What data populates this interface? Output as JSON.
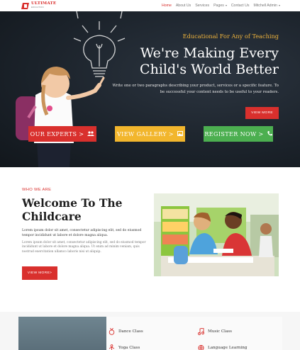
{
  "header": {
    "logo_title": "ULTIMATE",
    "logo_sub": "EDUCATION",
    "nav": [
      {
        "label": "Home",
        "active": true,
        "dropdown": false
      },
      {
        "label": "About Us",
        "active": false,
        "dropdown": false
      },
      {
        "label": "Services",
        "active": false,
        "dropdown": false
      },
      {
        "label": "Pages",
        "active": false,
        "dropdown": true
      },
      {
        "label": "Contact Us",
        "active": false,
        "dropdown": false
      },
      {
        "label": "Mitchell Admin",
        "active": false,
        "dropdown": true
      }
    ]
  },
  "hero": {
    "eyebrow": "Educational For Any of Teaching",
    "title": "We're Making Every Child's World Better",
    "description": "Write one or two paragraphs describing your product, services or a specific feature. To be successful your content needs to be useful to your readers.",
    "cta": "VIEW MORE",
    "buttons": {
      "experts": "OUR EXPERTS >",
      "gallery": "VIEW GALLERY >",
      "register": "REGISTER NOW >"
    }
  },
  "welcome": {
    "eyebrow": "WHO WE ARE",
    "title": "Welcome To The Childcare",
    "lead": "Lorem ipsum dolor sit amet, consectetur adipiscing elit, sed do eiusmod tempor incididunt ut labore et dolore magna aliqua.",
    "paragraph": "Lorem ipsum dolor sit amet, consectetur adipiscing elit, sed do eiusmod tempor incididunt ut labore et dolore magna aliqua. Ut enim ad minim veniam, quis nostrud exercitation ullamco laboris nisi ut aliquip.",
    "button": "VIEW MORE>"
  },
  "classes": [
    {
      "label": "Dance Class",
      "icon": "medal-icon"
    },
    {
      "label": "Music Class",
      "icon": "music-note-icon"
    },
    {
      "label": "Yoga Class",
      "icon": "yoga-icon"
    },
    {
      "label": "Language Learning",
      "icon": "globe-icon"
    }
  ],
  "colors": {
    "accent": "#d9302d",
    "yellow": "#f2b62d",
    "green": "#4caf50",
    "hero_bg": "#1b222a",
    "eyebrow": "#f0b43c"
  }
}
